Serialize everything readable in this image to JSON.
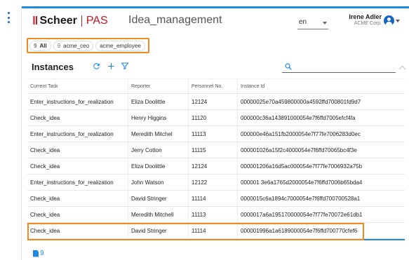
{
  "header": {
    "logo_mark": "‖",
    "logo_text": "Scheer",
    "logo_product": "PAS",
    "app_title": "Idea_management",
    "language": "en",
    "user_name": "Irene Adler",
    "user_company": "ACME Corp."
  },
  "chips": [
    {
      "count": "9",
      "label": "All"
    },
    {
      "count": "9",
      "label": "acme_ceo"
    },
    {
      "count": "",
      "label": "acme_employee"
    }
  ],
  "instances": {
    "title": "Instances",
    "search_placeholder": ""
  },
  "table": {
    "columns": [
      "Current Task",
      "Reporter",
      "Personnel No.",
      "Instance Id"
    ],
    "rows": [
      [
        "Enter_instructions_for_realization",
        "Eliza Doolittle",
        "12124",
        "00000025e70a459800000a4592ffd700801fd9d7"
      ],
      [
        "Check_idea",
        "Henry Higgins",
        "11120",
        "000000c36a143891000054e7f6ffd7005efcf4fa"
      ],
      [
        "Enter_instructions_for_realization",
        "Meredith Mitchel",
        "11113",
        "000000e46a151fb2000054e7f77fe7006283d0ec"
      ],
      [
        "Check_idea",
        "Jerry Cotton",
        "11115",
        "000001026a15f2c4000054e7f6ffd70065bc4f3e"
      ],
      [
        "Check_idea",
        "Eliza Doolittle",
        "12124",
        "000001206a16d5ac000054e7f77fe7006932a75b"
      ],
      [
        "Enter_instructions_for_realization",
        "John Watson",
        "12122",
        "000001 3e6a1765d2000054e7f6ffd7006b65bda4"
      ],
      [
        "Check_idea",
        "David Stringer",
        "11114",
        "0000015c6a1894c7000054e7f6ffd700700528a1"
      ],
      [
        "Check_idea",
        "Meredith Mitchell",
        "11113",
        "0000017a6a195170000054e7f77fe70072e61db1"
      ],
      [
        "Check_idea",
        "David Stringer",
        "11114",
        "000001996a1a6189000054e7f6ffd700770cfef6"
      ]
    ]
  },
  "footer": {
    "count": "9"
  },
  "colors": {
    "accent": "#1e88e5",
    "brand_red": "#c0161f",
    "highlight": "#ef8a1f"
  }
}
